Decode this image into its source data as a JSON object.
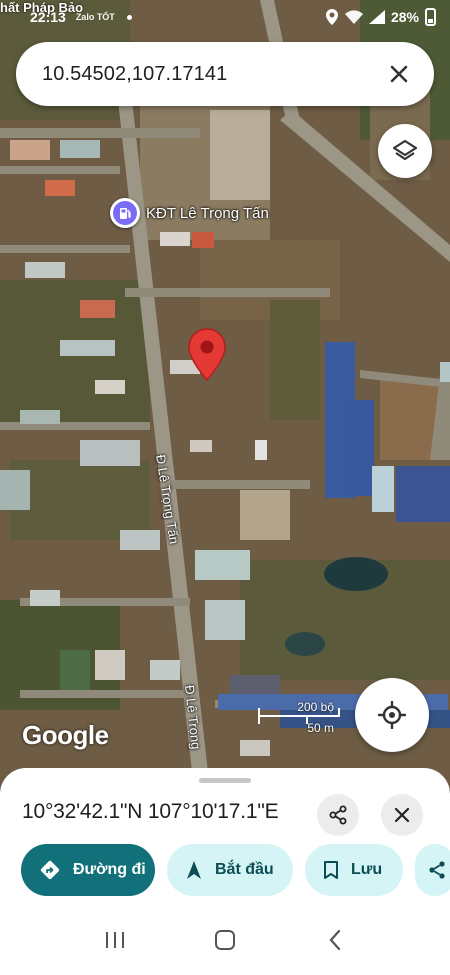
{
  "status_bar": {
    "time": "22:13",
    "mini_icons": "Zalo  TỐT",
    "battery": "28%"
  },
  "corner_text": "hất Pháp Bảo",
  "search": {
    "query": "10.54502,107.17141",
    "close_icon": "close-icon"
  },
  "map": {
    "poi_label": "KĐT Lê Trọng Tấn",
    "road_label_1": "Đ Lê Trọng Tấn",
    "road_label_2": "Đ Lê Trọng",
    "google_logo": "Google",
    "scale_top": "200 bộ",
    "scale_bottom": "50 m",
    "pin_color": "#e53935",
    "poi_color": "#7a6cf5"
  },
  "sheet": {
    "coordinates": "10°32'42.1\"N 107°10'17.1\"E",
    "actions": {
      "directions": "Đường đi",
      "start": "Bắt đầu",
      "save": "Lưu"
    }
  },
  "colors": {
    "primary": "#12707b",
    "secondary": "#d5f4f6"
  }
}
